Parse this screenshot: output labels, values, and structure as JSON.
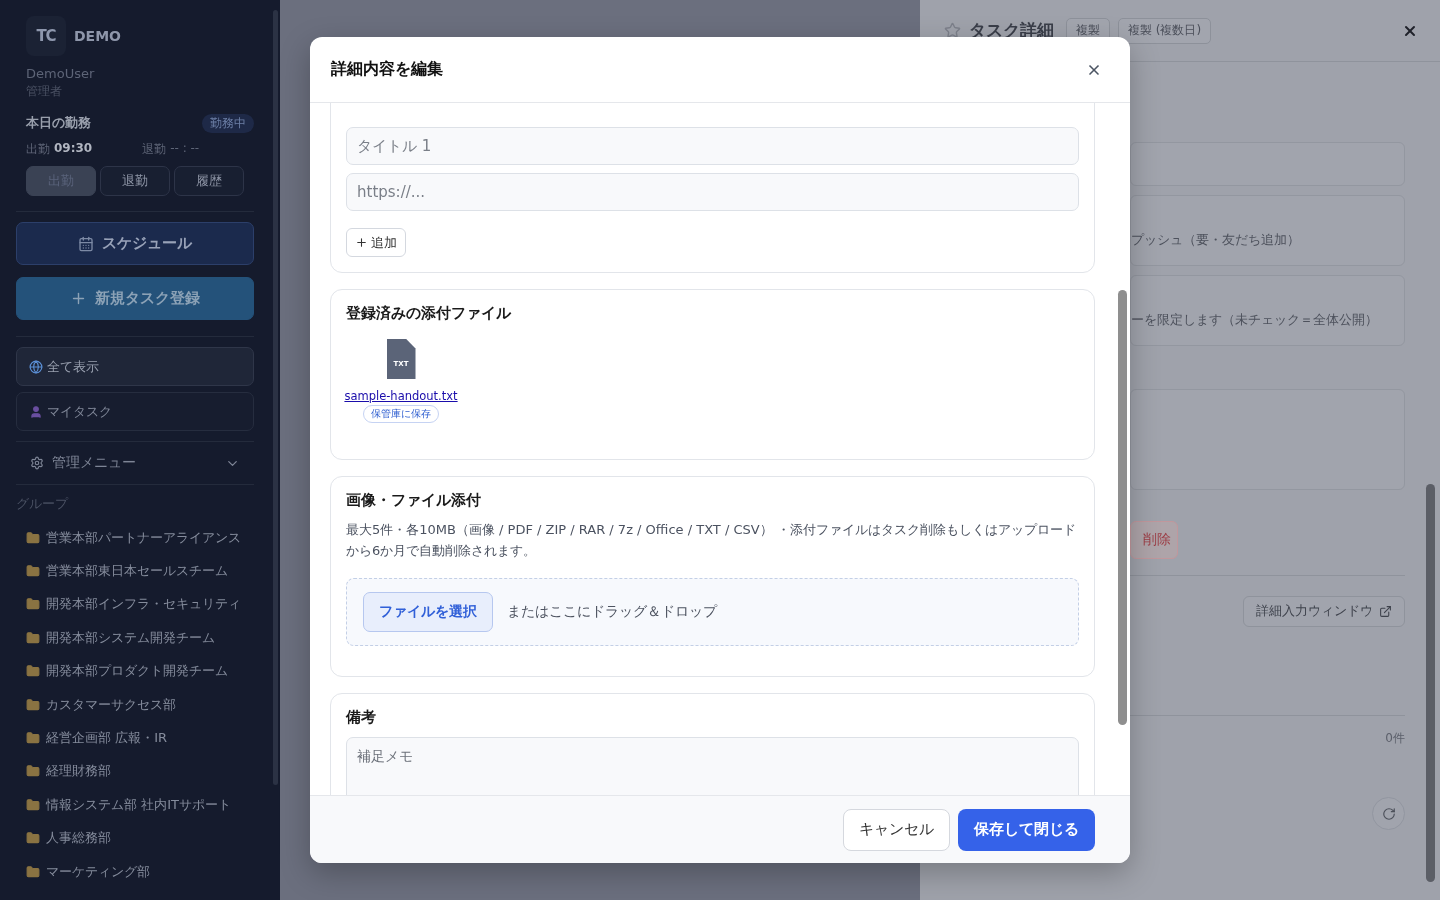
{
  "sidebar": {
    "logo_text": "TC",
    "brand": "DEMO",
    "user_name": "DemoUser",
    "user_role": "管理者",
    "attendance": {
      "title": "本日の勤務",
      "status": "勤務中",
      "clock_in_label": "出勤",
      "clock_in_time": "09:30",
      "clock_out_label": "退勤",
      "clock_out_time": "-- : --",
      "buttons": [
        {
          "label": "出勤",
          "disabled": true
        },
        {
          "label": "退勤",
          "disabled": false
        },
        {
          "label": "履歴",
          "disabled": false
        }
      ]
    },
    "schedule_button": "スケジュール",
    "new_task_button": "新規タスク登録",
    "nav": [
      {
        "label": "全て表示",
        "kind": "globe",
        "selected": true
      },
      {
        "label": "マイタスク",
        "kind": "user",
        "selected": false
      }
    ],
    "admin_menu": {
      "label": "管理メニュー",
      "expanded": false
    },
    "groups_title": "グループ",
    "groups": [
      "営業本部パートナーアライアンス",
      "営業本部東日本セールスチーム",
      "開発本部インフラ・セキュリティ",
      "開発本部システム開発チーム",
      "開発本部プロダクト開発チーム",
      "カスタマーサクセス部",
      "経営企画部 広報・IR",
      "経理財務部",
      "情報システム部 社内ITサポート",
      "人事総務部",
      "マーケティング部"
    ]
  },
  "detail_panel": {
    "title": "タスク詳細",
    "starred": false,
    "buttons": [
      "複製",
      "複製 (複数日)"
    ],
    "fields": [
      {
        "kind": "input"
      },
      {
        "kind": "option",
        "text": "プッシュ（要・友だち追加）"
      },
      {
        "kind": "option",
        "text": "ーを限定します（未チェック＝全体公開）"
      },
      {
        "kind": "textarea"
      }
    ],
    "delete_button": "削除",
    "popup_button": "詳細入力ウィンドウ",
    "count": "0件"
  },
  "modal": {
    "title": "詳細内容を編集",
    "links": {
      "title_placeholder": "タイトル 1",
      "url_placeholder": "https://...",
      "add_button": "追加"
    },
    "attachments": {
      "title": "登録済みの添付ファイル",
      "files": [
        {
          "type_label": "TXT",
          "name": "sample-handout.txt",
          "badge": "保管庫に保存"
        }
      ]
    },
    "upload": {
      "title": "画像・ファイル添付",
      "description": "最大5件・各10MB（画像 / PDF / ZIP / RAR / 7z / Office / TXT / CSV） ・添付ファイルはタスク削除もしくはアップロードから6か月で自動削除されます。",
      "choose_button": "ファイルを選択",
      "drop_hint": "またはここにドラッグ＆ドロップ"
    },
    "notes": {
      "title": "備考",
      "placeholder": "補足メモ"
    },
    "cancel_button": "キャンセル",
    "save_button": "保存して閉じる"
  }
}
